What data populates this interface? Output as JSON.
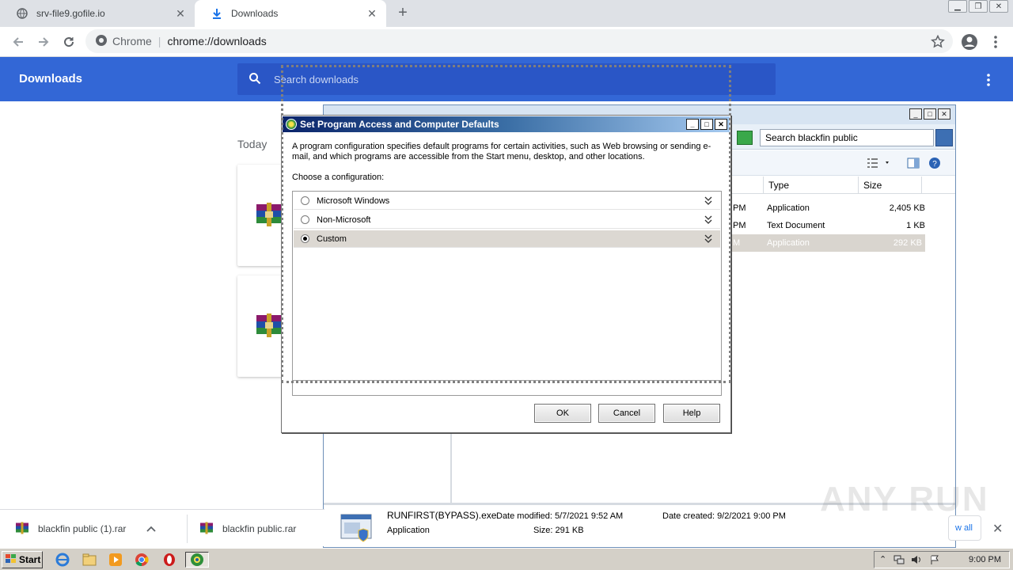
{
  "browser": {
    "tabs": [
      {
        "title": "srv-file9.gofile.io",
        "active": false
      },
      {
        "title": "Downloads",
        "active": true
      }
    ],
    "omnibox": {
      "site_label": "Chrome",
      "url": "chrome://downloads"
    }
  },
  "downloads_page": {
    "title": "Downloads",
    "search_placeholder": "Search downloads",
    "section": "Today"
  },
  "explorer": {
    "search_placeholder": "Search blackfin public",
    "columns": [
      "Type",
      "Size"
    ],
    "rows": [
      {
        "time": "PM",
        "type": "Application",
        "size": "2,405 KB"
      },
      {
        "time": "PM",
        "type": "Text Document",
        "size": "1 KB"
      },
      {
        "time": "M",
        "type": "Application",
        "size": "292 KB"
      }
    ],
    "details": {
      "filename": "RUNFIRST(BYPASS).exe",
      "modified": "Date modified: 5/7/2021 9:52 AM",
      "created": "Date created: 9/2/2021 9:00 PM",
      "kind": "Application",
      "size": "Size: 291 KB"
    }
  },
  "dialog": {
    "title": "Set Program Access and Computer Defaults",
    "description": "A program configuration specifies default programs for certain activities, such as Web browsing or sending e-mail, and which programs are accessible from the Start menu, desktop, and other locations.",
    "choose_label": "Choose a configuration:",
    "configurations": [
      {
        "label": "Microsoft Windows",
        "selected": false
      },
      {
        "label": "Non-Microsoft",
        "selected": false
      },
      {
        "label": "Custom",
        "selected": true
      }
    ],
    "buttons": {
      "ok": "OK",
      "cancel": "Cancel",
      "help": "Help"
    }
  },
  "shelf": {
    "items": [
      "blackfin public (1).rar",
      "blackfin public.rar"
    ],
    "show_all": "w all"
  },
  "watermark": "ANY RUN",
  "taskbar": {
    "start_label": "Start",
    "clock": "9:00 PM"
  }
}
